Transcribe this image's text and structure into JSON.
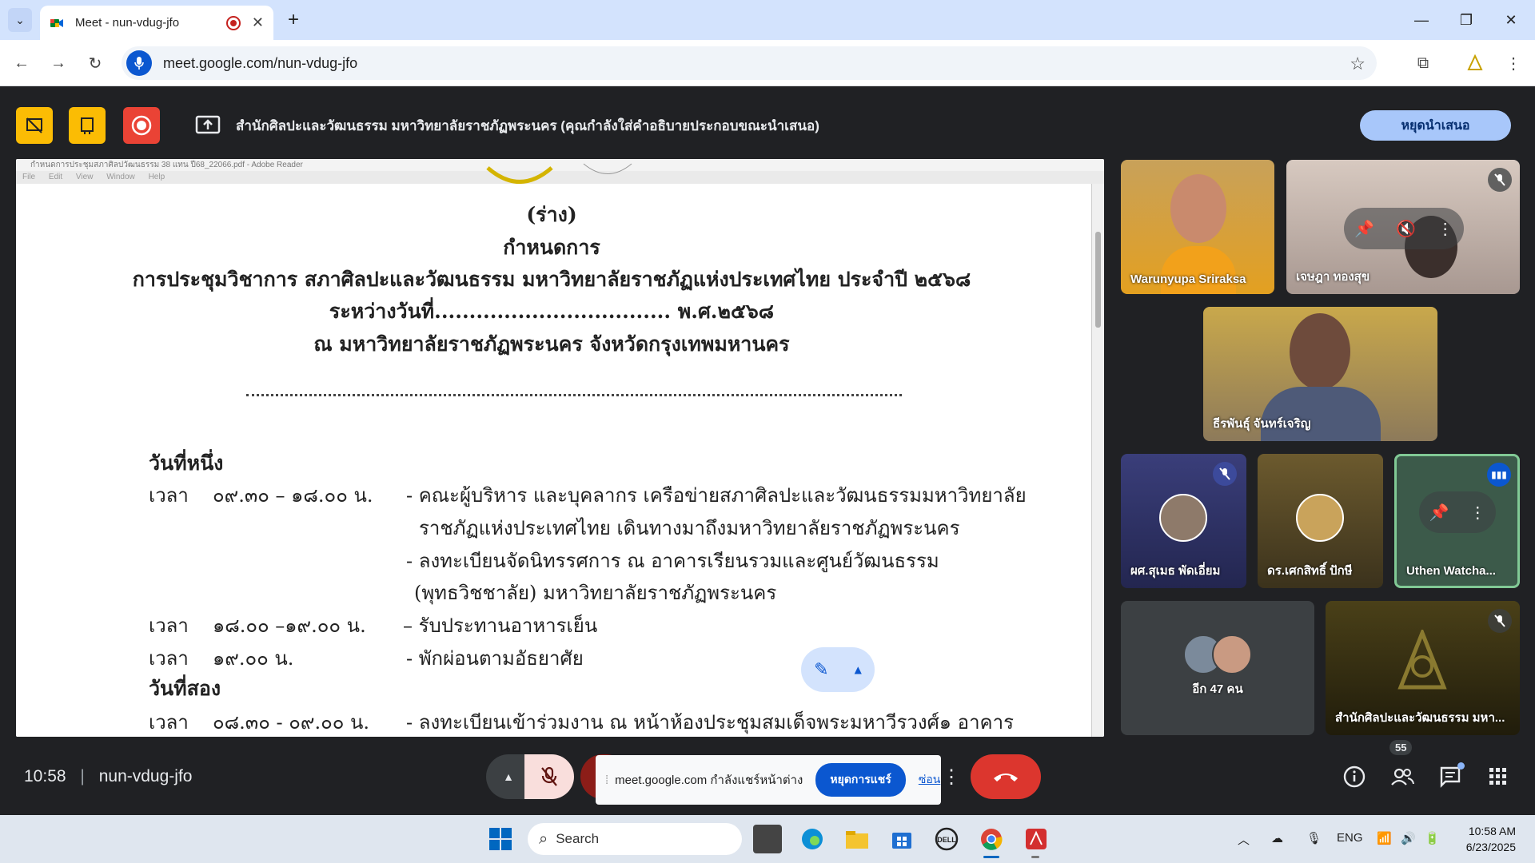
{
  "browser": {
    "tab_title": "Meet - nun-vdug-jfo",
    "url": "meet.google.com/nun-vdug-jfo",
    "new_tab": "+",
    "tab_close": "✕"
  },
  "present_bar": {
    "message": "สำนักศิลปะและวัฒนธรรม มหาวิทยาลัยราชภัฏพระนคร (คุณกำลังใส่คำอธิบายประกอบขณะนำเสนอ)",
    "stop_button": "หยุดนำเสนอ",
    "colors": {
      "yellow": "#fbbc04",
      "red": "#ea4335"
    }
  },
  "shared_window": {
    "title": "กำหนดการประชุมสภาศิลปวัฒนธรรม 38 แทน ปี68_22066.pdf - Adobe Reader",
    "menu": [
      "File",
      "Edit",
      "View",
      "Window",
      "Help"
    ],
    "doc": {
      "line1": "(ร่าง)",
      "line2": "กำหนดการ",
      "line3": "การประชุมวิชาการ สภาศิลปะและวัฒนธรรม มหาวิทยาลัยราชภัฏแห่งประเทศไทย ประจำปี ๒๕๖๘",
      "line4": "ระหว่างวันที่.................................. พ.ศ.๒๕๖๘",
      "line5": "ณ  มหาวิทยาลัยราชภัฏพระนคร จังหวัดกรุงเทพมหานคร",
      "day1": "วันที่หนึ่ง",
      "day2": "วันที่สอง",
      "time_label": "เวลา",
      "r1_time": "๐๙.๓๐ – ๑๘.๐๐ น.",
      "r1_a": "- คณะผู้บริหาร และบุคลากร เครือข่ายสภาศิลปะและวัฒนธรรมมหาวิทยาลัย",
      "r1_b": "ราชภัฏแห่งประเทศไทย เดินทางมาถึงมหาวิทยาลัยราชภัฏพระนคร",
      "r1_c": "- ลงทะเบียนจัดนิทรรศการ  ณ อาคารเรียนรวมและศูนย์วัฒนธรรม",
      "r1_d": "(พุทธวิชชาลัย) มหาวิทยาลัยราชภัฏพระนคร",
      "r2_time": "๑๘.๐๐ –๑๙.๐๐ น.",
      "r2_a": "– รับประทานอาหารเย็น",
      "r3_time": "๑๙.๐๐  น.",
      "r3_a": "- พักผ่อนตามอัธยาศัย",
      "r4_time": "๐๘.๓๐ - ๐๙.๐๐ น.",
      "r4_a": "- ลงทะเบียนเข้าร่วมงาน ณ หน้าห้องประชุมสมเด็จพระมหาวีรวงศ์๑  อาคาร"
    }
  },
  "participants": {
    "p1": "Warunyupa Sriraksa",
    "p2": "เจษฎา ทองสุข",
    "p3": "ธีรพันธุ์ จันทร์เจริญ",
    "p4": "ผศ.สุเมธ พัดเอี่ยม",
    "p5": "ดร.เศกสิทธิ์ ปักษี",
    "p6": "Uthen Watcha...",
    "p7": "อีก 47 คน",
    "p8": "สำนักศิลปะและวัฒนธรรม มหา..."
  },
  "bottom": {
    "time": "10:58",
    "meeting_code": "nun-vdug-jfo",
    "share_notice": "meet.google.com กำลังแชร์หน้าต่าง",
    "stop_share": "หยุดการแชร์",
    "hide": "ซ่อน",
    "people_count": "55"
  },
  "taskbar": {
    "search": "Search",
    "lang": "ENG",
    "clock_time": "10:58 AM",
    "clock_date": "6/23/2025"
  }
}
